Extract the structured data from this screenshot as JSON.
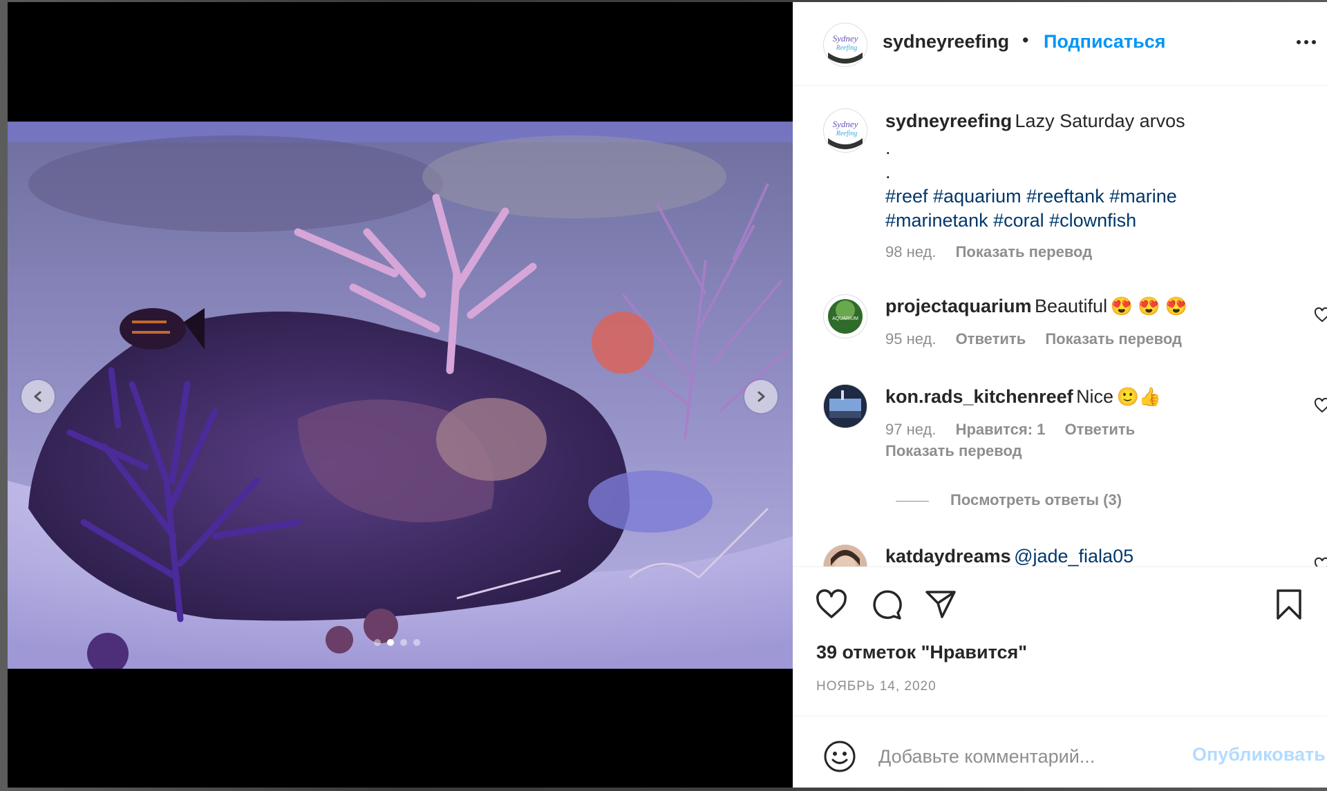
{
  "header": {
    "username": "sydneyreefing",
    "separator": "•",
    "follow_label": "Подписаться"
  },
  "caption": {
    "username": "sydneyreefing",
    "text": "Lazy Saturday arvos",
    "dot1": ".",
    "dot2": ".",
    "tags_line1": "#reef #aquarium #reeftank #marine",
    "tags_line2": "#marinetank #coral #clownfish",
    "time": "98 нед.",
    "translate": "Показать перевод"
  },
  "comments": [
    {
      "username": "projectaquarium",
      "text": "Beautiful",
      "emoji": "😍 😍 😍",
      "time": "95 нед.",
      "reply": "Ответить",
      "translate": "Показать перевод",
      "avatar_label": "AQUARIUM"
    },
    {
      "username": "kon.rads_kitchenreef",
      "text": "Nice",
      "emoji": "🙂👍",
      "time": "97 нед.",
      "likes": "Нравится: 1",
      "reply": "Ответить",
      "translate": "Показать перевод",
      "view_replies": "Посмотреть ответы (3)"
    },
    {
      "username": "katdaydreams",
      "mention": "@jade_fiala05"
    }
  ],
  "likes_text": "39 отметок \"Нравится\"",
  "date_text": "НОЯБРЬ 14, 2020",
  "comment_box": {
    "placeholder": "Добавьте комментарий...",
    "publish_label": "Опубликовать"
  },
  "logo_text": "Sydney Reefing",
  "carousel": {
    "slide_count": 4,
    "active_index": 1
  },
  "colors": {
    "link": "#0095f6",
    "hashtag": "#00376b",
    "muted": "#8e8e8e"
  }
}
